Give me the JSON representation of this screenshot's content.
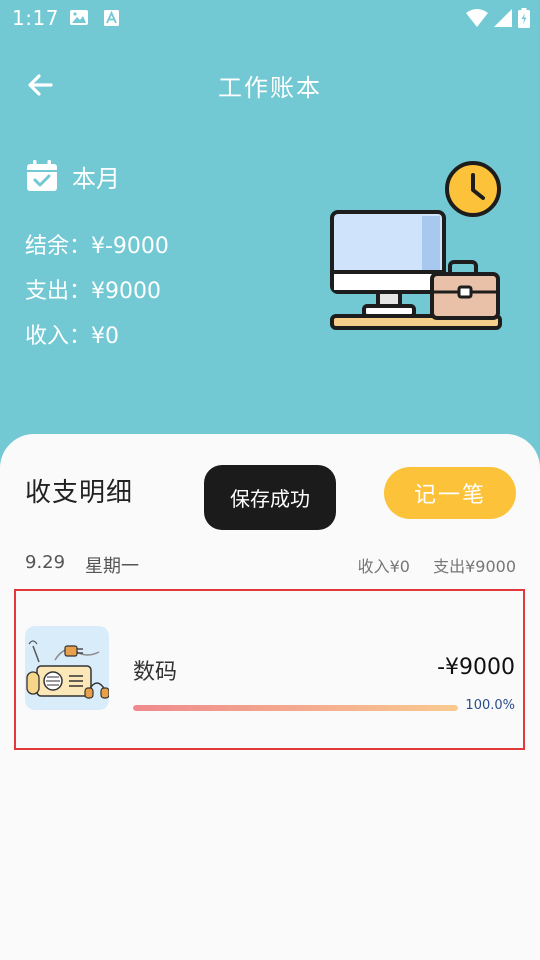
{
  "status_bar": {
    "time": "1:17"
  },
  "header": {
    "title": "工作账本"
  },
  "summary": {
    "period_label": "本月",
    "balance_text": "结余：¥-9000",
    "expense_text": "支出：¥9000",
    "income_text": "收入：¥0"
  },
  "details": {
    "title": "收支明细",
    "add_label": "记一笔",
    "toast": "保存成功"
  },
  "day_group": {
    "date": "9.29",
    "weekday": "星期一",
    "income": "收入¥0",
    "expense": "支出¥9000"
  },
  "records": [
    {
      "category": "数码",
      "amount": "-¥9000",
      "percent_text": "100.0%",
      "percent_value": 100,
      "icon": "digital-device-icon"
    }
  ],
  "colors": {
    "background": "#72C9D4",
    "accent_button": "#FCC33A",
    "toast_bg": "#1b1b1b",
    "progress_start": "#EF8A8E",
    "progress_end": "#F9C98F",
    "highlight_border": "#E0383B"
  }
}
